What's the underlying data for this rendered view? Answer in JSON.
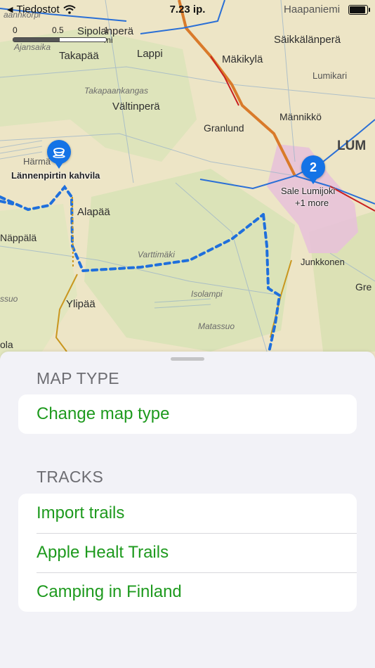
{
  "status_bar": {
    "back_app": "Tiedostot",
    "time": "7.23 ip."
  },
  "scale": {
    "labels": [
      "0",
      "0.5",
      "1 mi"
    ]
  },
  "map": {
    "places": [
      "Sipolanperä",
      "Haapaniemi",
      "Säikkälänperä",
      "Takapää",
      "Lappi",
      "Mäkikylä",
      "Lumikari",
      "Vältinperä",
      "Granlund",
      "Männikkö",
      "LUM",
      "Alapää",
      "Näppälä",
      "Junkkonen",
      "Ylipää",
      "Gre",
      "ola",
      "Härmä",
      "Ajansaika",
      "aannkorpi"
    ],
    "minor_places": [
      "Takapaankangas",
      "Varttimäki",
      "Isolampi",
      "Matassuo",
      "ssuo"
    ],
    "poi": {
      "label": "Lännenpirtin kahvila",
      "icon": "coffee-cup-icon"
    },
    "cluster": {
      "count": "2",
      "label": "Sale Lumijoki",
      "more": "+1 more"
    }
  },
  "sheet": {
    "map_type": {
      "header": "MAP TYPE",
      "items": [
        "Change map type"
      ]
    },
    "tracks": {
      "header": "TRACKS",
      "items": [
        "Import trails",
        "Apple Healt Trails",
        "Camping in Finland"
      ]
    }
  },
  "colors": {
    "accent": "#1e9a1e",
    "pin": "#1473e6",
    "trail": "#1f6fdc"
  }
}
